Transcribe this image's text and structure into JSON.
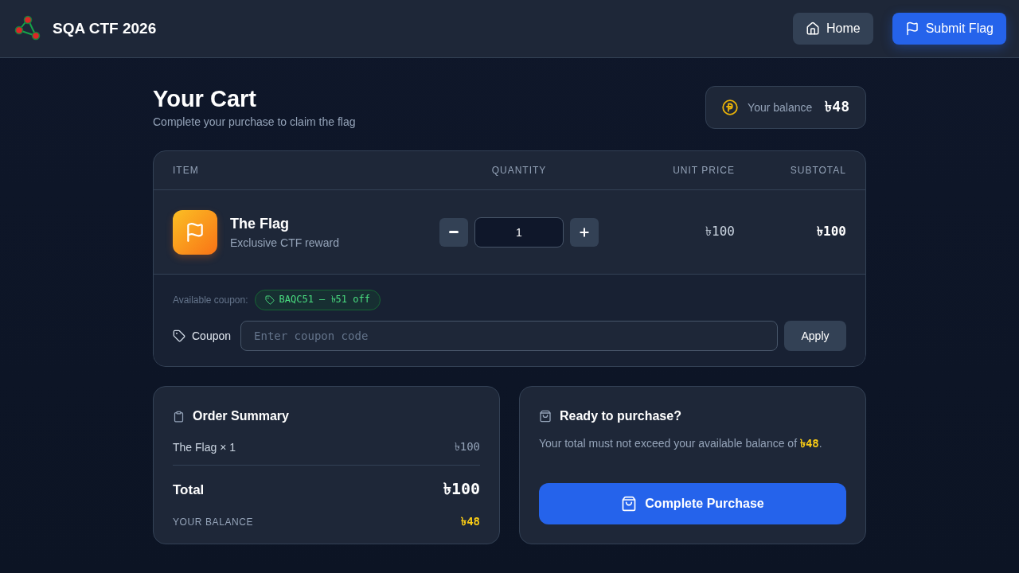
{
  "header": {
    "title": "SQA CTF 2026",
    "buttons": [
      {
        "label": "Home",
        "kind": "home"
      },
      {
        "label": "Submit Flag",
        "kind": "flag"
      }
    ]
  },
  "page": {
    "title": "Your Cart",
    "subtitle": "Complete your purchase to claim the flag"
  },
  "balance": {
    "label": "Your balance",
    "amount": "৳48"
  },
  "cart": {
    "columns": [
      "ITEM",
      "QUANTITY",
      "UNIT PRICE",
      "SUBTOTAL"
    ],
    "items": [
      {
        "name": "The Flag",
        "description": "Exclusive CTF reward",
        "quantity": "1",
        "unit_price": "৳100",
        "subtotal": "৳100"
      }
    ]
  },
  "coupon": {
    "available_label": "Available coupon:",
    "chip": "BAQC51 — ৳51 off",
    "field_label": "Coupon",
    "placeholder": "Enter coupon code",
    "apply": "Apply"
  },
  "summary": {
    "title": "Order Summary",
    "lines": [
      {
        "label": "The Flag × 1",
        "amount": "৳100"
      }
    ],
    "total": {
      "label": "Total",
      "amount": "৳100"
    },
    "balance": {
      "label": "YOUR BALANCE",
      "amount": "৳48"
    }
  },
  "purchase": {
    "title": "Ready to purchase?",
    "note": "Your total must not exceed your available balance of **৳48**.",
    "button": "Complete Purchase"
  }
}
